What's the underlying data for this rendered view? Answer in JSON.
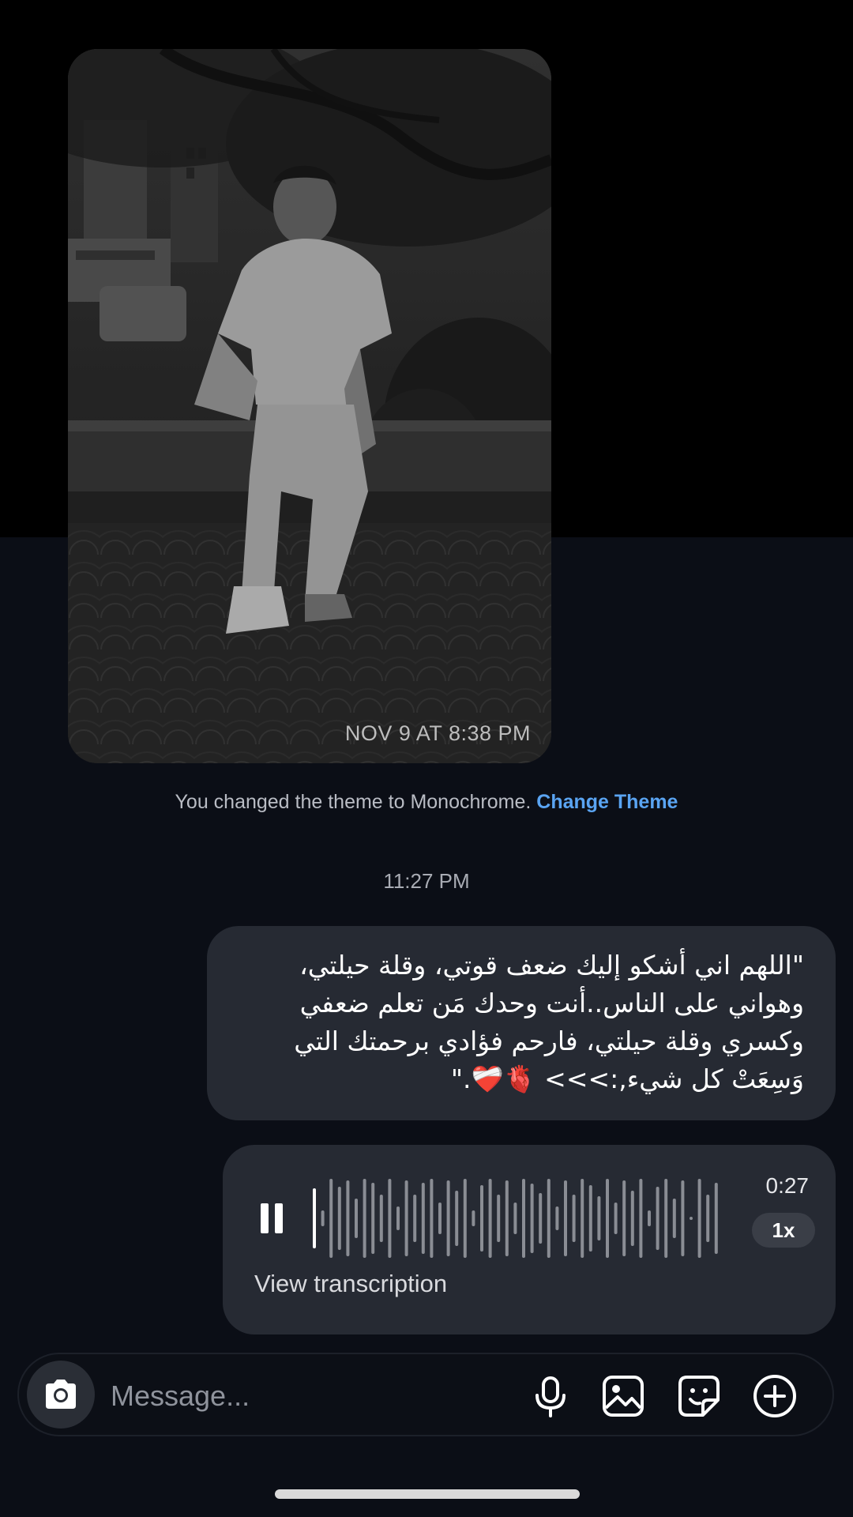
{
  "photo_message": {
    "timestamp": "NOV 9 AT 8:38 PM"
  },
  "system_note": {
    "text": "You changed the theme to Monochrome.",
    "link": "Change Theme"
  },
  "divider_time": "11:27 PM",
  "text_message": {
    "body": "\"اللهم اني أشكو إليك ضعف قوتي، وقلة حيلتي، وهواني على الناس..أنت وحدك مَن تعلم ضعفي وكسري وقلة حيلتي، فارحم فؤادي برحمتك التي وَسِعَتْ كل شيء,:>>> 🫀❤️‍🩹.\""
  },
  "voice_message": {
    "duration": "0:27",
    "speed": "1x",
    "transcription_label": "View transcription",
    "state": "playing"
  },
  "composer": {
    "placeholder": "Message...",
    "icons": [
      "camera-icon",
      "microphone-icon",
      "gallery-icon",
      "sticker-icon",
      "plus-icon"
    ]
  },
  "colors": {
    "bubble": "#262a33",
    "link": "#5aa4f2",
    "background": "#0b0e16"
  }
}
